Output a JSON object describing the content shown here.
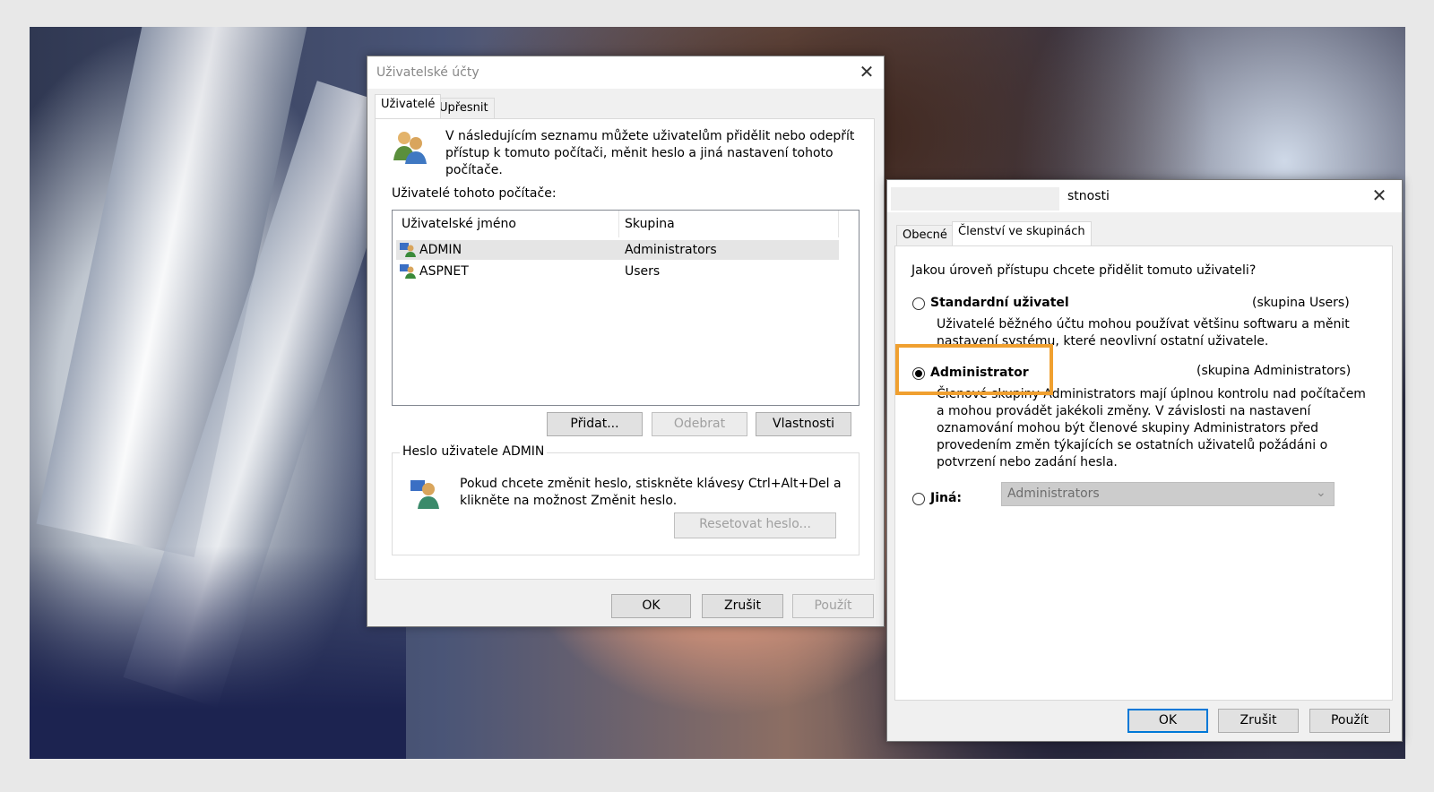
{
  "user_accounts": {
    "title": "Uživatelské účty",
    "tabs": [
      "Uživatelé",
      "Upřesnit"
    ],
    "intro": [
      "V následujícím seznamu můžete uživatelům přidělit nebo odepřít",
      "přístup k tomuto počítači, měnit heslo a jiná nastavení tohoto",
      "počítače."
    ],
    "users_label": "Uživatelé tohoto počítače:",
    "columns": [
      "Uživatelské jméno",
      "Skupina"
    ],
    "rows": [
      {
        "name": "ADMIN",
        "group": "Administrators"
      },
      {
        "name": "ASPNET",
        "group": "Users"
      }
    ],
    "buttons": {
      "add": "Přidat...",
      "remove": "Odebrat",
      "properties": "Vlastnosti"
    },
    "password_group": {
      "title": "Heslo uživatele ADMIN",
      "text": [
        "Pokud chcete změnit heslo, stiskněte klávesy Ctrl+Alt+Del a",
        "klikněte na možnost Změnit heslo."
      ],
      "reset": "Resetovat heslo..."
    },
    "footer": {
      "ok": "OK",
      "cancel": "Zrušit",
      "apply": "Použít"
    }
  },
  "properties": {
    "title_suffix": "stnosti",
    "tabs": [
      "Obecné",
      "Členství ve skupinách"
    ],
    "question": "Jakou úroveň přístupu chcete přidělit tomuto uživateli?",
    "standard": {
      "label": "Standardní uživatel",
      "group": "(skupina Users)",
      "desc": [
        "Uživatelé běžného účtu mohou používat většinu softwaru a měnit",
        "nastavení systému, které neovlivní ostatní uživatele."
      ],
      "checked": false
    },
    "administrator": {
      "label": "Administrator",
      "group": "(skupina Administrators)",
      "desc": [
        "Členové skupiny Administrators mají úplnou kontrolu nad počítačem",
        "a mohou provádět jakékoli změny. V závislosti na nastavení",
        "oznamování mohou být členové skupiny Administrators před",
        "provedením změn týkajících se ostatních uživatelů požádáni o",
        "potvrzení nebo zadání hesla."
      ],
      "checked": true
    },
    "other": {
      "label": "Jiná:",
      "value": "Administrators",
      "checked": false
    },
    "footer": {
      "ok": "OK",
      "cancel": "Zrušit",
      "apply": "Použít"
    }
  },
  "colors": {
    "highlight": "#f0a030",
    "accent": "#0078d7"
  }
}
